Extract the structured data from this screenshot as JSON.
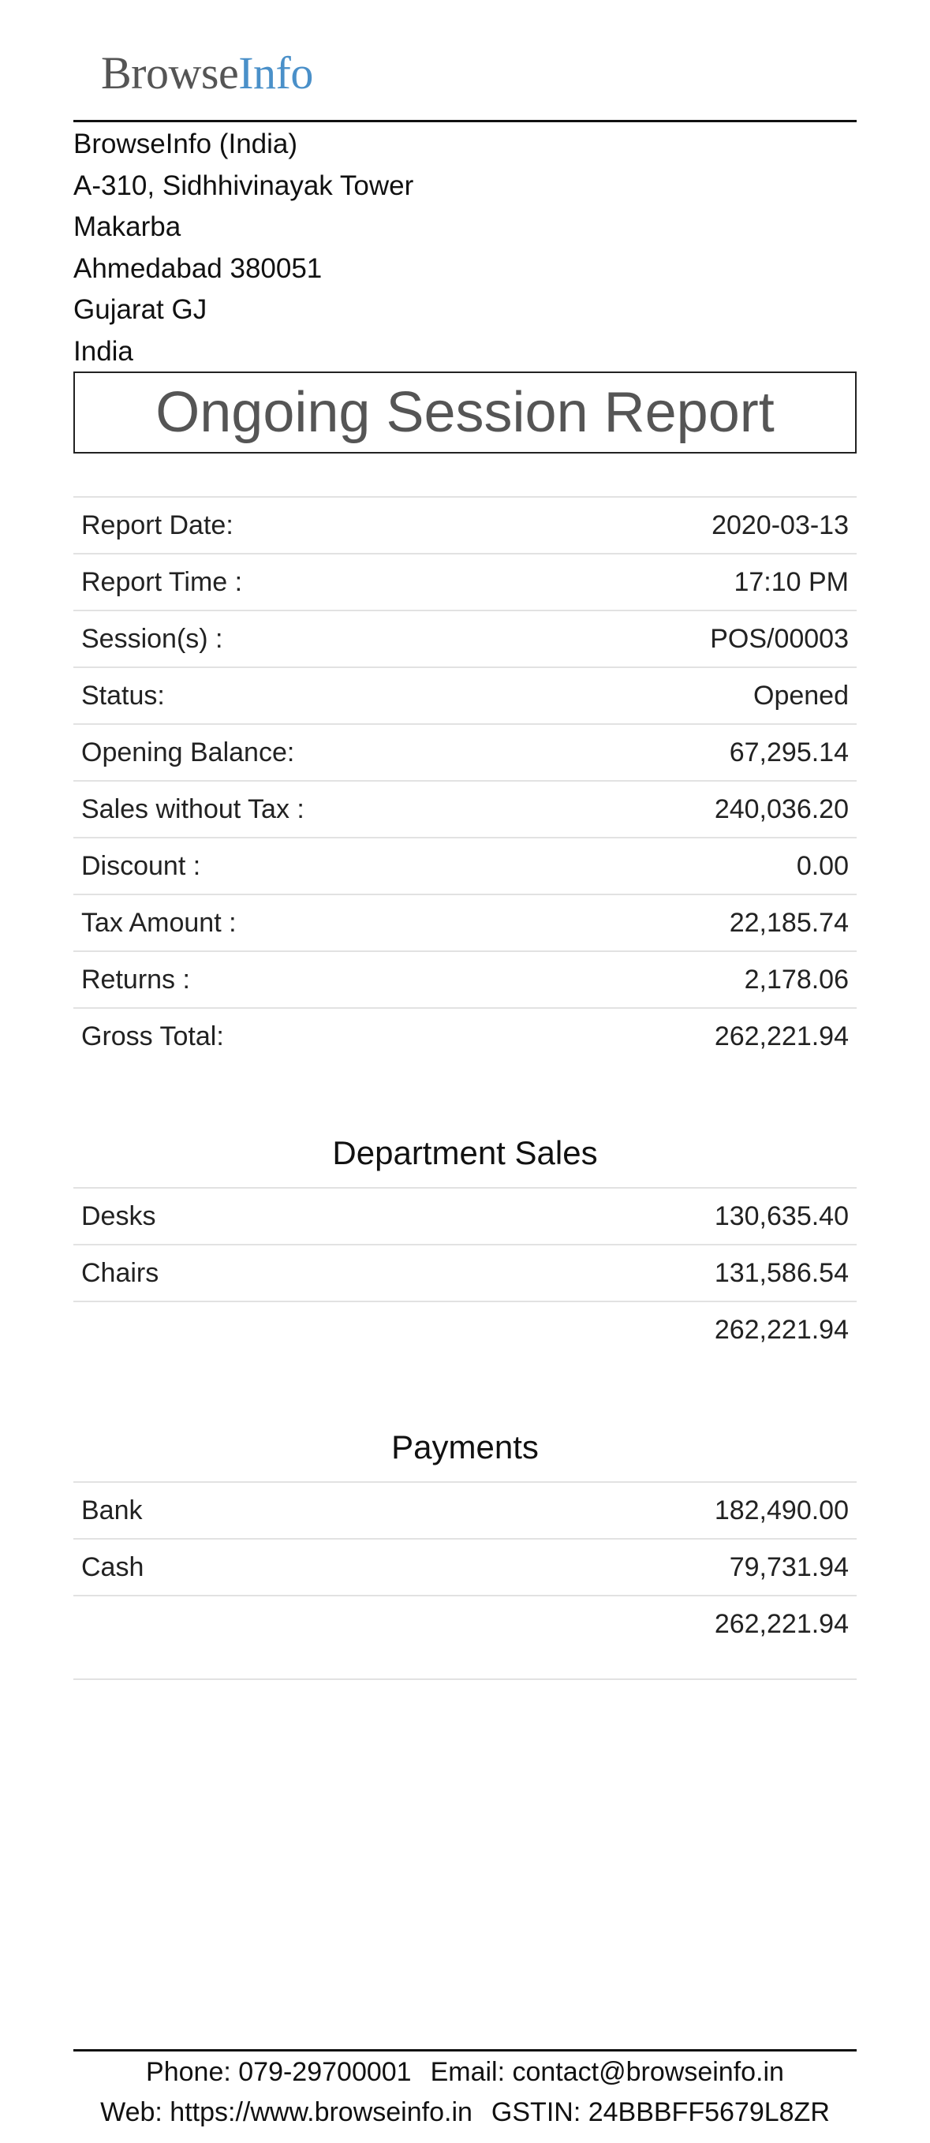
{
  "logo": {
    "part1": "Browse",
    "part2": "Info",
    "accent_color": "#4a90c9"
  },
  "company": {
    "lines": [
      "BrowseInfo (India)",
      "A-310, Sidhhivinayak Tower",
      "Makarba",
      "Ahmedabad 380051",
      "Gujarat GJ",
      "India"
    ]
  },
  "report": {
    "title": "Ongoing Session Report",
    "summary": [
      {
        "label": "Report Date:",
        "value": "2020-03-13"
      },
      {
        "label": "Report Time :",
        "value": "17:10 PM"
      },
      {
        "label": "Session(s) :",
        "value": "POS/00003"
      },
      {
        "label": "Status:",
        "value": "Opened"
      },
      {
        "label": "Opening Balance:",
        "value": "67,295.14"
      },
      {
        "label": "Sales without Tax :",
        "value": "240,036.20"
      },
      {
        "label": "Discount :",
        "value": "0.00"
      },
      {
        "label": "Tax Amount :",
        "value": "22,185.74"
      },
      {
        "label": "Returns :",
        "value": "2,178.06"
      },
      {
        "label": "Gross Total:",
        "value": "262,221.94"
      }
    ]
  },
  "department_sales": {
    "title": "Department Sales",
    "rows": [
      {
        "label": "Desks",
        "value": "130,635.40"
      },
      {
        "label": "Chairs",
        "value": "131,586.54"
      }
    ],
    "total": "262,221.94"
  },
  "payments": {
    "title": "Payments",
    "rows": [
      {
        "label": "Bank",
        "value": "182,490.00"
      },
      {
        "label": "Cash",
        "value": "79,731.94"
      }
    ],
    "total": "262,221.94"
  },
  "footer": {
    "phone": "Phone: 079-29700001",
    "email": "Email: contact@browseinfo.in",
    "web": "Web: https://www.browseinfo.in",
    "gstin": "GSTIN: 24BBBFF5679L8ZR"
  }
}
